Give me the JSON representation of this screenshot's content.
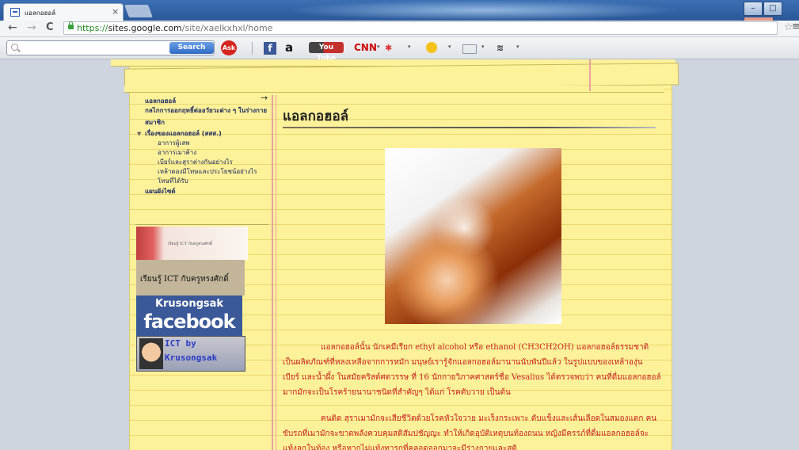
{
  "browser": {
    "tab_title": "แอลกอฮอล์",
    "tab_close": "×",
    "url_scheme": "https://",
    "url_host": "sites.google.com",
    "url_path": "/site/xaelkxhxl/home",
    "back": "←",
    "forward": "→",
    "reload": "C",
    "star": "☆",
    "menu": "≡",
    "minimize": "–",
    "maximize": "□",
    "close": "x"
  },
  "toolbar": {
    "search_button": "Search",
    "ask": "Ask",
    "facebook": "f",
    "amazon": "a",
    "youtube": "You Tube",
    "cnn": "CNN",
    "dropdown": "▾"
  },
  "sidebar": {
    "items": [
      {
        "label": "แอลกอฮอล์"
      },
      {
        "label": "กลไกการออกฤทธิ์ต่ออวัยวะต่าง ๆ ในร่างกาย"
      },
      {
        "label": "สมาชิก"
      },
      {
        "label": "เรื่องของแอลกอฮอล์ (สสส.)"
      }
    ],
    "subitems": [
      {
        "label": "อาการผู้เสพ"
      },
      {
        "label": "อาการเมาค้าง"
      },
      {
        "label": "เบียร์และสุราต่างกันอย่างไร"
      },
      {
        "label": "เหล้าดองมีโทษและประโยชน์อย่างไร"
      },
      {
        "label": "โทษที่ได้รับ"
      }
    ],
    "sitemap": "แผนผังไซต์",
    "ict_banner": "เรียนรู้ ICT กับครูทรงศักดิ์",
    "fb_name": "Krusongsak",
    "fb_word": "facebook",
    "ictby_line1": "ICT by",
    "ictby_line2": "Krusongsak"
  },
  "main": {
    "title": "แอลกอฮอล์",
    "paragraph1": "แอลกอฮอล์นั้น นักเคมีเรียก ethyl alcohol หรือ ethanol (CH3CH2OH) แอลกอฮอล์ธรรมชาติเป็นผลิตภัณฑ์ที่หลงเหลือจากการหมัก มนุษย์เรารู้จักแอลกอฮอล์มานานนับพันปีแล้ว ในรูปแบบของเหล้าองุ่น เบียร์ และน้ำผึ้ง ในสมัยคริสต์ศตวรรษ ที่ 16 นักกายวิภาคศาสตร์ชื่อ Vesalius ได้ตรวจพบว่า คนที่ดื่มแอลกอฮอล์มากมักจะเป็นโรคร้ายนานาชนิดที่สำคัญๆ ได้แก่ โรคตับวาย เป็นต้น",
    "paragraph2": "คนติด สุราเมามักจะเสียชีวิตด้วยโรคหัวใจวาย มะเร็งกระเพาะ ตับแข็งและเส้นเลือดในสมองแตก คนขับรถที่เมามักจะขาดพลังควบคุมสติสัมปชัญญะ ทำให้เกิดอุบัติเหตุบนท้องถนน หญิงมีครรภ์ที่ดื่มแอลกอฮอล์จะแท้งลูกในท้อง หรือหากไม่แท้งทารกที่คลอดออกมาจะมีร่างกายและสติ"
  }
}
